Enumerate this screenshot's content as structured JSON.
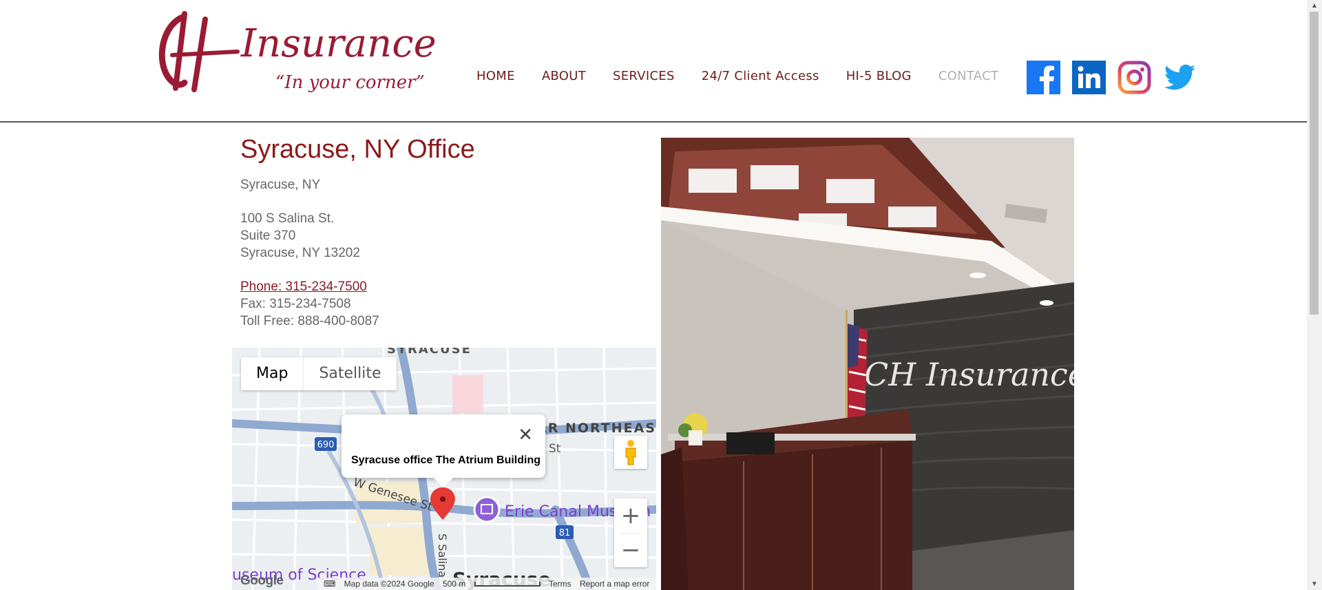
{
  "brand": {
    "logo_letters": "CH",
    "logo_word": "Insurance",
    "tagline": "“In your corner”"
  },
  "nav": [
    {
      "label": "HOME"
    },
    {
      "label": "ABOUT"
    },
    {
      "label": "SERVICES"
    },
    {
      "label": "24/7 Client Access"
    },
    {
      "label": "HI-5 BLOG"
    },
    {
      "label": "CONTACT"
    }
  ],
  "social": [
    "facebook-icon",
    "linkedin-icon",
    "instagram-icon",
    "twitter-icon"
  ],
  "office": {
    "title": "Syracuse, NY Office",
    "city": "Syracuse, NY",
    "street": "100 S Salina St.",
    "suite": "Suite 370",
    "city_zip": "Syracuse, NY 13202",
    "phone": "Phone: 315-234-7500",
    "fax": "Fax: 315-234-7508",
    "toll_free": "Toll Free: 888-400-8087"
  },
  "map": {
    "toggle_map": "Map",
    "toggle_satellite": "Satellite",
    "infowindow_text": "Syracuse office The Atrium Building",
    "footer_data": "Map data ©2024 Google",
    "footer_scale": "500 m",
    "footer_terms": "Terms",
    "footer_report": "Report a map error",
    "google_logo": "Google",
    "labels": {
      "syracuse_top": "SYRACUSE",
      "northeast": "AR NORTHEAST",
      "genesee": "W Genesee St",
      "erie_canal": "Erie Canal Museum",
      "salina": "S Salina",
      "syracuse_bottom": "Syracuse",
      "science": "useum of Science",
      "route_690": "690",
      "route_81": "81",
      "st": "St"
    }
  },
  "photo": {
    "sign_text": "CH Insurance"
  },
  "colors": {
    "brand": "#8b1a2a",
    "nav": "#6b1d1d",
    "nav_active": "#b0b0b0",
    "facebook": "#1877f2",
    "linkedin": "#0a66c2",
    "twitter": "#1da1f2"
  }
}
